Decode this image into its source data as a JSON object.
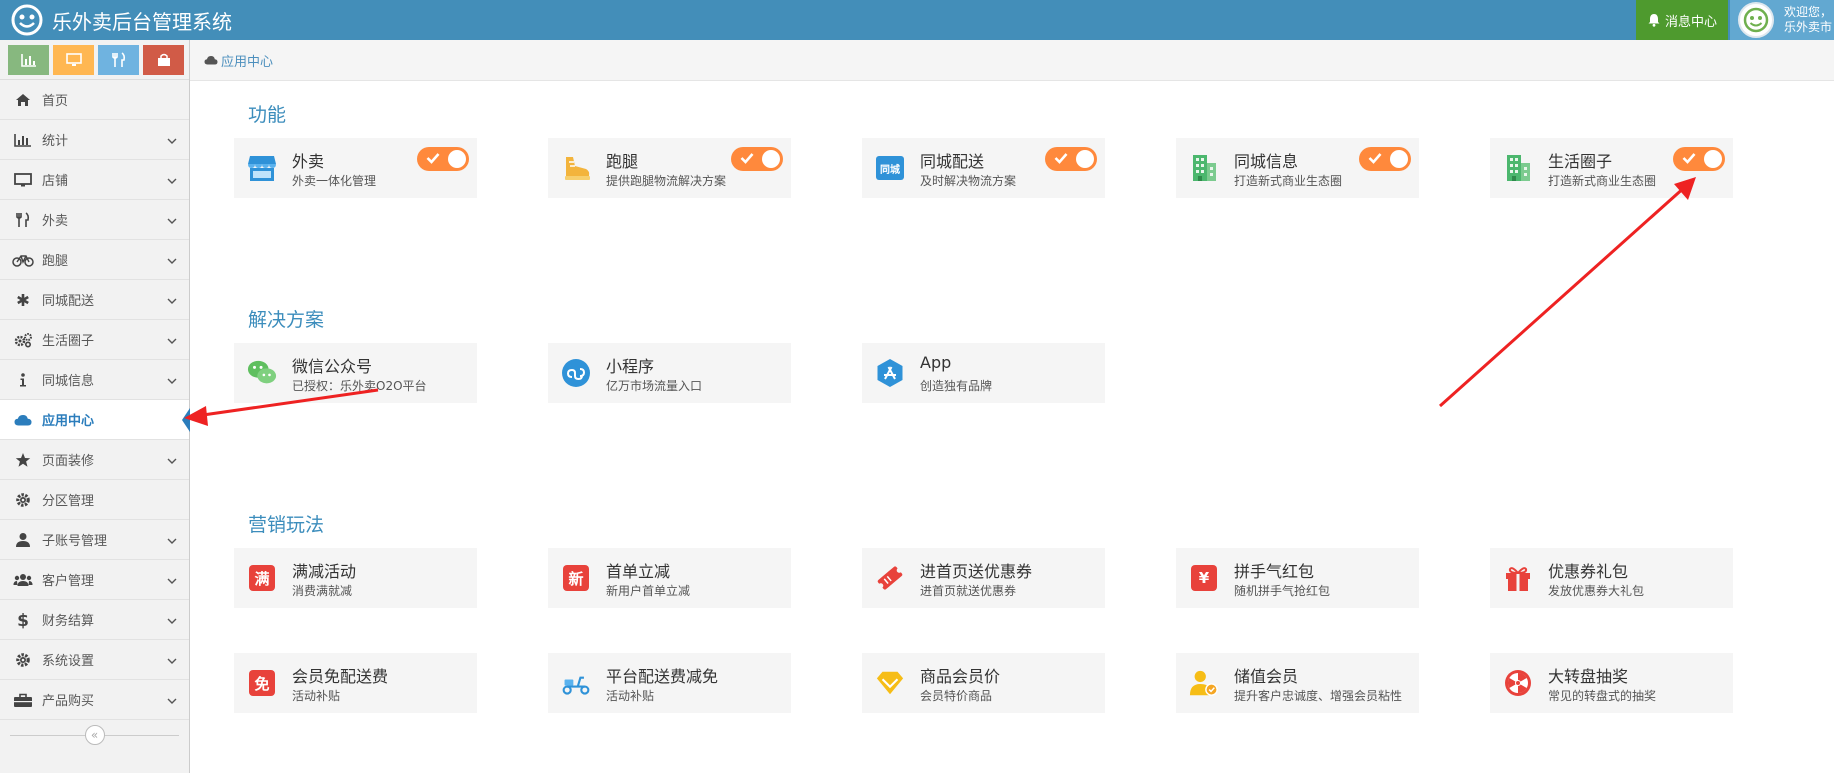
{
  "header": {
    "title": "乐外卖后台管理系统",
    "message_center": "消息中心",
    "welcome": "欢迎您，",
    "username": "乐外卖市"
  },
  "colors": {
    "header_bg": "#438eb9",
    "accent": "#3c8dbc",
    "toggle_on": "#ff893c",
    "message_bg": "#4e9a2e"
  },
  "shortcuts": [
    {
      "icon": "bar-chart-icon",
      "color": "#87b87f"
    },
    {
      "icon": "desktop-icon",
      "color": "#ffb752"
    },
    {
      "icon": "cutlery-icon",
      "color": "#6fb3e0"
    },
    {
      "icon": "shopping-bag-icon",
      "color": "#d15b47"
    }
  ],
  "breadcrumb": {
    "label": "应用中心"
  },
  "sidebar": {
    "items": [
      {
        "label": "首页",
        "icon": "home-icon",
        "expandable": false
      },
      {
        "label": "统计",
        "icon": "bar-chart-icon",
        "expandable": true
      },
      {
        "label": "店铺",
        "icon": "desktop-icon",
        "expandable": true
      },
      {
        "label": "外卖",
        "icon": "cutlery-icon",
        "expandable": true
      },
      {
        "label": "跑腿",
        "icon": "bicycle-icon",
        "expandable": true
      },
      {
        "label": "同城配送",
        "icon": "asterisk-icon",
        "expandable": true
      },
      {
        "label": "生活圈子",
        "icon": "gears-icon",
        "expandable": true
      },
      {
        "label": "同城信息",
        "icon": "info-icon",
        "expandable": true
      },
      {
        "label": "应用中心",
        "icon": "cloud-icon",
        "expandable": false,
        "active": true
      },
      {
        "label": "页面装修",
        "icon": "star-icon",
        "expandable": true
      },
      {
        "label": "分区管理",
        "icon": "cog-icon",
        "expandable": false
      },
      {
        "label": "子账号管理",
        "icon": "user-icon",
        "expandable": true
      },
      {
        "label": "客户管理",
        "icon": "users-icon",
        "expandable": true
      },
      {
        "label": "财务结算",
        "icon": "dollar-icon",
        "expandable": true
      },
      {
        "label": "系统设置",
        "icon": "cog-icon",
        "expandable": true
      },
      {
        "label": "产品购买",
        "icon": "suitcase-icon",
        "expandable": true
      }
    ],
    "collapse_label": "«"
  },
  "sections": {
    "features": {
      "title": "功能",
      "cards": [
        {
          "name": "外卖",
          "desc": "外卖一体化管理",
          "icon": "shop-icon",
          "enabled": true
        },
        {
          "name": "跑腿",
          "desc": "提供跑腿物流解决方案",
          "icon": "runner-shoe-icon",
          "enabled": true
        },
        {
          "name": "同城配送",
          "desc": "及时解决物流方案",
          "icon": "city-delivery-icon",
          "enabled": true
        },
        {
          "name": "同城信息",
          "desc": "打造新式商业生态圈",
          "icon": "building-icon",
          "enabled": true
        },
        {
          "name": "生活圈子",
          "desc": "打造新式商业生态圈",
          "icon": "building-icon",
          "enabled": true
        }
      ]
    },
    "solutions": {
      "title": "解决方案",
      "cards": [
        {
          "name": "微信公众号",
          "desc": "已授权：乐外卖O2O平台",
          "icon": "wechat-icon"
        },
        {
          "name": "小程序",
          "desc": "亿万市场流量入口",
          "icon": "mini-program-icon"
        },
        {
          "name": "App",
          "desc": "创造独有品牌",
          "icon": "app-store-icon"
        }
      ]
    },
    "marketing": {
      "title": "营销玩法",
      "cards": [
        {
          "name": "满减活动",
          "desc": "消费满就减",
          "icon": "full-reduction-icon",
          "glyph": "满"
        },
        {
          "name": "首单立减",
          "desc": "新用户首单立减",
          "icon": "new-user-icon",
          "glyph": "新"
        },
        {
          "name": "进首页送优惠券",
          "desc": "进首页就送优惠券",
          "icon": "coupon-ticket-icon"
        },
        {
          "name": "拼手气红包",
          "desc": "随机拼手气抢红包",
          "icon": "red-packet-icon",
          "glyph": "¥"
        },
        {
          "name": "优惠券礼包",
          "desc": "发放优惠券大礼包",
          "icon": "gift-icon"
        },
        {
          "name": "会员免配送费",
          "desc": "活动补贴",
          "icon": "free-delivery-icon",
          "glyph": "免"
        },
        {
          "name": "平台配送费减免",
          "desc": "活动补贴",
          "icon": "scooter-icon"
        },
        {
          "name": "商品会员价",
          "desc": "会员特价商品",
          "icon": "diamond-icon"
        },
        {
          "name": "储值会员",
          "desc": "提升客户忠诚度、增强会员粘性",
          "icon": "member-icon"
        },
        {
          "name": "大转盘抽奖",
          "desc": "常见的转盘式的抽奖",
          "icon": "wheel-icon"
        }
      ]
    }
  }
}
